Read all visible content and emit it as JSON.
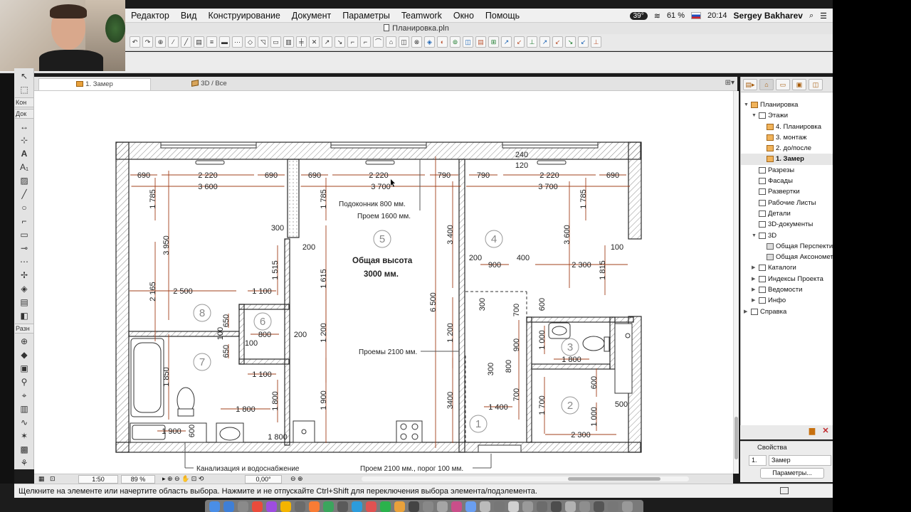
{
  "menubar": {
    "items": [
      "Редактор",
      "Вид",
      "Конструирование",
      "Документ",
      "Параметры",
      "Teamwork",
      "Окно",
      "Помощь"
    ],
    "temperature": "39°",
    "battery": "61 %",
    "time": "20:14",
    "user": "Sergey Bakharev"
  },
  "window": {
    "title": "Планировка.pln"
  },
  "toolbox": {
    "labels": [
      "Кон",
      "Док",
      "Разн"
    ]
  },
  "tabs": [
    {
      "label": "1. Замер",
      "icon": "floor-plan-icon",
      "active": true
    },
    {
      "label": "3D / Все",
      "icon": "3d-cube-icon",
      "active": false
    }
  ],
  "navigator": {
    "tree": [
      {
        "label": "Планировка",
        "level": 0,
        "expanded": true,
        "icon": "project-icon"
      },
      {
        "label": "Этажи",
        "level": 1,
        "expanded": true,
        "icon": "stories-icon"
      },
      {
        "label": "4. Планировка",
        "level": 2,
        "icon": "story-icon"
      },
      {
        "label": "3. монтаж",
        "level": 2,
        "icon": "story-icon"
      },
      {
        "label": "2. до/после",
        "level": 2,
        "icon": "story-icon"
      },
      {
        "label": "1. Замер",
        "level": 2,
        "icon": "story-icon",
        "selected": true
      },
      {
        "label": "Разрезы",
        "level": 1,
        "icon": "sections-icon"
      },
      {
        "label": "Фасады",
        "level": 1,
        "icon": "elevations-icon"
      },
      {
        "label": "Развертки",
        "level": 1,
        "icon": "interior-elevations-icon"
      },
      {
        "label": "Рабочие Листы",
        "level": 1,
        "icon": "worksheets-icon"
      },
      {
        "label": "Детали",
        "level": 1,
        "icon": "details-icon"
      },
      {
        "label": "3D-документы",
        "level": 1,
        "icon": "3d-documents-icon"
      },
      {
        "label": "3D",
        "level": 1,
        "expanded": true,
        "icon": "3d-icon"
      },
      {
        "label": "Общая Перспекти",
        "level": 2,
        "icon": "perspective-icon"
      },
      {
        "label": "Общая Аксономет",
        "level": 2,
        "icon": "axonometry-icon"
      },
      {
        "label": "Каталоги",
        "level": 1,
        "collapsed": true,
        "icon": "schedules-icon"
      },
      {
        "label": "Индексы Проекта",
        "level": 1,
        "collapsed": true,
        "icon": "project-indexes-icon"
      },
      {
        "label": "Ведомости",
        "level": 1,
        "collapsed": true,
        "icon": "lists-icon"
      },
      {
        "label": "Инфо",
        "level": 1,
        "collapsed": true,
        "icon": "info-icon"
      },
      {
        "label": "Справка",
        "level": 0,
        "collapsed": true,
        "icon": "help-icon"
      }
    ],
    "properties": {
      "header": "Свойства",
      "index": "1.",
      "name": "Замер",
      "button": "Параметры..."
    }
  },
  "quickbar": {
    "scale": "1:50",
    "zoom": "89 %",
    "angle": "0,00°"
  },
  "status": {
    "text": "Щелкните на элементе или начертите область выбора. Нажмите и не отпускайте Ctrl+Shift для переключения выбора элемента/подэлемента."
  },
  "colors": {
    "dimension": "#a2401b",
    "wall": "#2a2a2a",
    "accent_orange": "#e8a13b"
  },
  "drawing": {
    "dims": [
      "690",
      "2 220",
      "690",
      "690",
      "2 220",
      "790",
      "790",
      "2 220",
      "690",
      "240",
      "120",
      "3 600",
      "3 700",
      "3 700",
      "1 785",
      "1 785",
      "1 785",
      "3 950",
      "2 165",
      "300",
      "200",
      "1 515",
      "1 615",
      "3 400",
      "6 500",
      "3 600",
      "1 815",
      "200",
      "400",
      "900",
      "2 300",
      "100",
      "2 500",
      "1 100",
      "650",
      "650",
      "100",
      "800",
      "200",
      "100",
      "1 200",
      "1 200",
      "300",
      "700",
      "600",
      "1 000",
      "1 800",
      "1 100",
      "1 850",
      "1 800",
      "1 800",
      "1 900",
      "1 900",
      "3400",
      "300",
      "800",
      "900",
      "700",
      "1 700",
      "600",
      "500",
      "1 400",
      "2 300",
      "1 000",
      "1 800",
      "600"
    ],
    "rooms": [
      "1",
      "2",
      "3",
      "4",
      "5",
      "6",
      "7",
      "8"
    ],
    "notes": {
      "sill": "Подоконник 800 мм.",
      "opening": "Проем 1600 мм.",
      "height_1": "Общая высота",
      "height_2": "3000 мм.",
      "openings": "Проемы 2100 мм.",
      "sewer": "Канализация и водоснабжение",
      "door": "Проем 2100 мм., порог 100 мм."
    }
  }
}
